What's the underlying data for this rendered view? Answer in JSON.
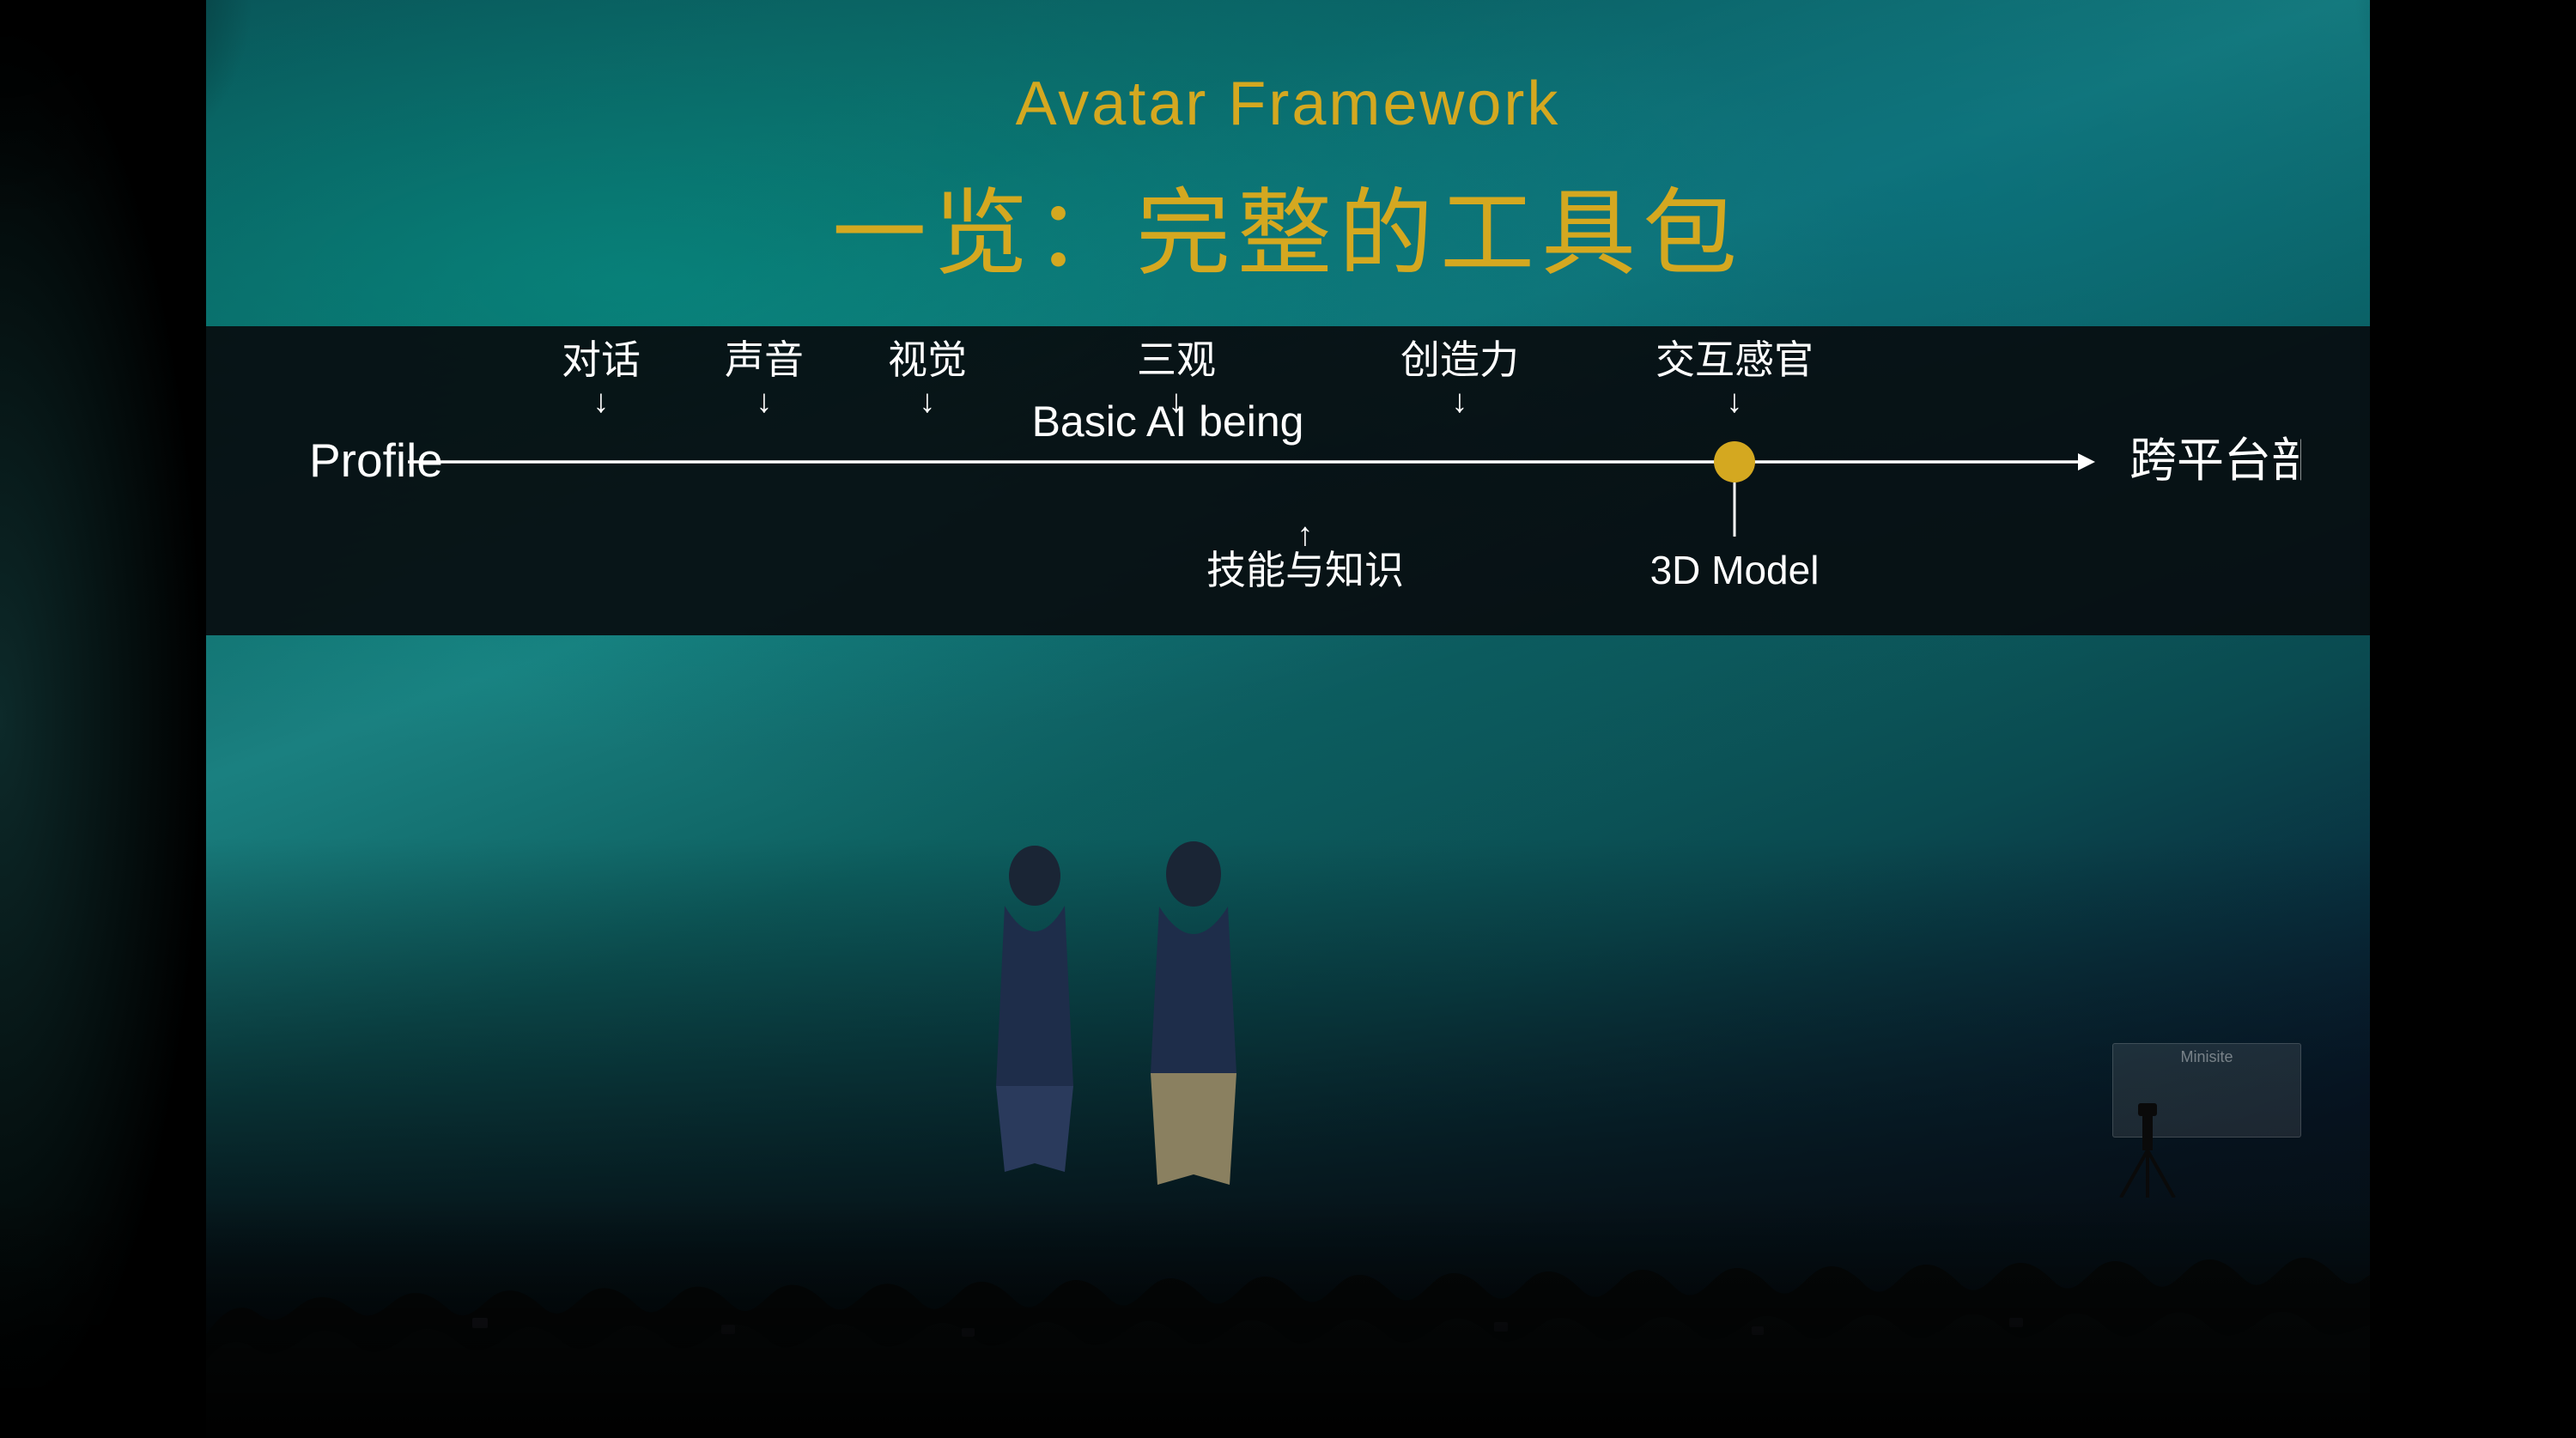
{
  "title": {
    "english": "Avatar Framework",
    "chinese": "一览：完整的工具包"
  },
  "diagram": {
    "left_label": "Profile",
    "center_label": "Basic AI being",
    "right_label": "跨平台部署",
    "top_labels": [
      "对话",
      "声音",
      "视觉",
      "三观",
      "创造力",
      "交互感官"
    ],
    "bottom_labels": [
      "技能与知识",
      "3D Model"
    ]
  },
  "colors": {
    "title_gold": "#d4a820",
    "background_teal": "#0d6060",
    "strip_dark": "#0a0e10",
    "text_white": "#ffffff",
    "dot_gold": "#d4a820"
  }
}
